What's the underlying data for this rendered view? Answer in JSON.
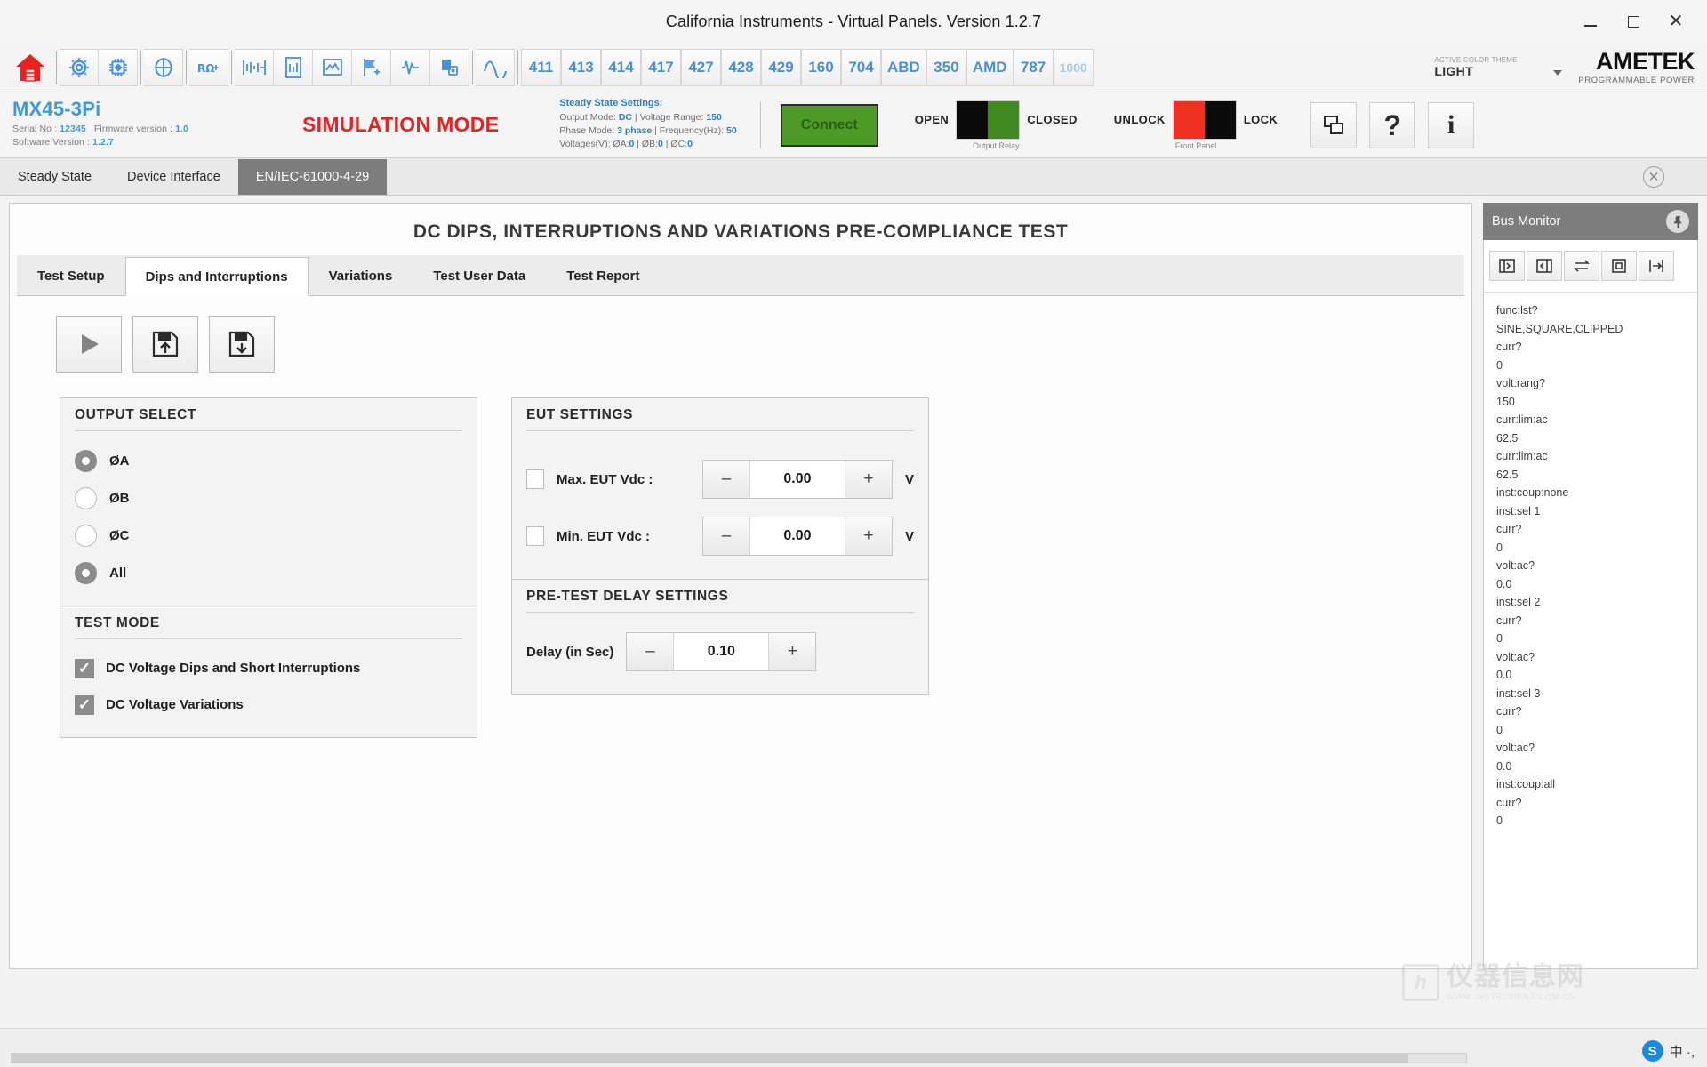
{
  "window": {
    "title": "California Instruments - Virtual Panels. Version 1.2.7",
    "minimize": "–",
    "maximize": "□",
    "close": "✕"
  },
  "toolbar": {
    "home_icon": "home-icon",
    "icons": [
      "gear-icon",
      "chip-icon",
      "meter-icon",
      "resistor-icon",
      "waveform-measure-icon",
      "report-icon",
      "monitor-icon",
      "flag-icon",
      "transient-icon",
      "device-config-icon",
      "sine-wave-icon"
    ],
    "standards": [
      "411",
      "413",
      "414",
      "417",
      "427",
      "428",
      "429",
      "160",
      "704",
      "ABD",
      "350",
      "AMD",
      "787",
      "1000"
    ],
    "theme_label": "ACTIVE COLOR THEME",
    "theme_value": "LIGHT",
    "brand_main": "AMETEK",
    "brand_sub": "PROGRAMMABLE POWER"
  },
  "info": {
    "model": "MX45-3Pi",
    "serial_label": "Serial No : ",
    "serial_value": "12345",
    "firmware_label": "Firmware version : ",
    "firmware_value": "1.0",
    "software_label": "Software Version : ",
    "software_value": "1.2.7",
    "simulation_mode": "SIMULATION MODE",
    "steady_state_title": "Steady State Settings:",
    "output_mode_label": "Output Mode: ",
    "output_mode_value": "DC",
    "voltage_range_label": " | Voltage Range: ",
    "voltage_range_value": "150",
    "phase_mode_label": "Phase Mode: ",
    "phase_mode_value": "3 phase",
    "frequency_label": " | Frequency(Hz): ",
    "frequency_value": "50",
    "voltages_label": "Voltages(V): ØA:",
    "voltage_a": "0",
    "voltage_b_label": " | ØB:",
    "voltage_b": "0",
    "voltage_c_label": " | ØC:",
    "voltage_c": "0",
    "connect_button": "Connect",
    "relay_open": "OPEN",
    "relay_closed": "CLOSED",
    "relay_caption": "Output Relay",
    "lock_unlock": "UNLOCK",
    "lock_lock": "LOCK",
    "lock_caption": "Front Panel",
    "clone_icon": "clone-window-icon",
    "help_icon": "help-icon",
    "about_icon": "about-info-icon"
  },
  "tabs": {
    "items": [
      {
        "label": "Steady State",
        "active": false
      },
      {
        "label": "Device Interface",
        "active": false
      },
      {
        "label": "EN/IEC-61000-4-29",
        "active": true
      }
    ],
    "close_icon": "close-tab-icon"
  },
  "page": {
    "title": "DC DIPS, INTERRUPTIONS AND VARIATIONS PRE-COMPLIANCE TEST",
    "inner_tabs": [
      {
        "label": "Test Setup",
        "active": false
      },
      {
        "label": "Dips and Interruptions",
        "active": true
      },
      {
        "label": "Variations",
        "active": false
      },
      {
        "label": "Test User Data",
        "active": false
      },
      {
        "label": "Test Report",
        "active": false
      }
    ],
    "actions": [
      {
        "name": "run-test-button",
        "icon": "play-icon"
      },
      {
        "name": "save-settings-button",
        "icon": "save-upload-icon"
      },
      {
        "name": "load-settings-button",
        "icon": "save-download-icon"
      }
    ]
  },
  "output_select": {
    "title": "OUTPUT SELECT",
    "options": [
      {
        "label": "ØA",
        "selected": true
      },
      {
        "label": "ØB",
        "selected": false
      },
      {
        "label": "ØC",
        "selected": false
      },
      {
        "label": "All",
        "selected": true
      }
    ]
  },
  "test_mode": {
    "title": "TEST MODE",
    "options": [
      {
        "label": "DC Voltage Dips and Short Interruptions",
        "checked": true
      },
      {
        "label": "DC Voltage Variations",
        "checked": true
      }
    ]
  },
  "eut_settings": {
    "title": "EUT SETTINGS",
    "rows": [
      {
        "label": "Max. EUT Vdc :",
        "checked": false,
        "minus": "–",
        "value": "0.00",
        "plus": "+",
        "unit": "V"
      },
      {
        "label": "Min. EUT Vdc :",
        "checked": false,
        "minus": "–",
        "value": "0.00",
        "plus": "+",
        "unit": "V"
      }
    ]
  },
  "pretest_delay": {
    "title": "PRE-TEST DELAY SETTINGS",
    "label": "Delay (in Sec)",
    "minus": "–",
    "value": "0.10",
    "plus": "+"
  },
  "bus_monitor": {
    "title": "Bus Monitor",
    "pin_icon": "pin-icon",
    "tools": [
      "open-log-icon",
      "clear-log-icon",
      "transfer-icon",
      "stop-icon",
      "export-icon"
    ],
    "log": [
      "func:lst?",
      "SINE,SQUARE,CLIPPED",
      "curr?",
      "0",
      "volt:rang?",
      "150",
      "curr:lim:ac",
      "62.5",
      "curr:lim:ac",
      "62.5",
      "inst:coup:none",
      "inst:sel 1",
      "curr?",
      "0",
      "volt:ac?",
      "0.0",
      "inst:sel 2",
      "curr?",
      "0",
      "volt:ac?",
      "0.0",
      "inst:sel 3",
      "curr?",
      "0",
      "volt:ac?",
      "0.0",
      "inst:coup:all",
      "curr?",
      "0"
    ]
  },
  "watermark": {
    "logo": "h",
    "text_cn": "仪器信息网",
    "url": "WWW.INSTRUMENT.COM.CN"
  },
  "ime": {
    "badge": "S",
    "text": "中 ·,"
  },
  "colors": {
    "accent_blue": "#3f9ad6",
    "alert_red": "#e8231f",
    "connect_green": "#4e9a26",
    "tab_active_gray": "#7d7d7d"
  }
}
